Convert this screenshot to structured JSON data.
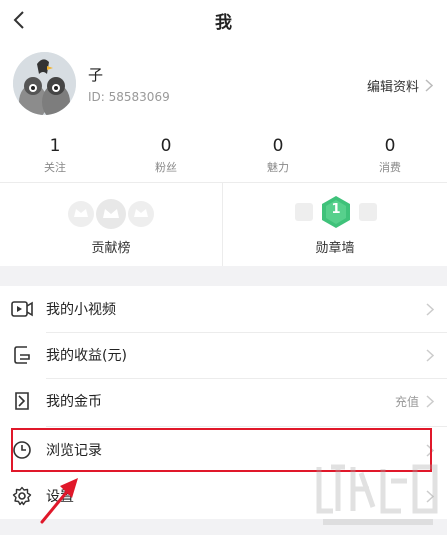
{
  "header": {
    "title": "我"
  },
  "profile": {
    "name": "子",
    "id_text": "ID: 58583069",
    "edit_label": "编辑资料"
  },
  "stats": [
    {
      "value": "1",
      "label": "关注"
    },
    {
      "value": "0",
      "label": "粉丝"
    },
    {
      "value": "0",
      "label": "魅力"
    },
    {
      "value": "0",
      "label": "消费"
    }
  ],
  "badges": [
    {
      "label": "贡献榜"
    },
    {
      "label": "勋章墙",
      "count": "1"
    }
  ],
  "menu": [
    {
      "label": "我的小视频",
      "trail": "",
      "icon": "video-icon"
    },
    {
      "label": "我的收益(元)",
      "trail": "",
      "icon": "wallet-icon"
    },
    {
      "label": "我的金币",
      "trail": "充值",
      "icon": "coin-book-icon"
    },
    {
      "label": "浏览记录",
      "trail": "",
      "icon": "clock-icon"
    },
    {
      "label": "设置",
      "trail": "",
      "icon": "gear-icon"
    }
  ],
  "colors": {
    "highlight": "#e0182a",
    "badge_green": "#3fc27a",
    "section_gap": "#f2f2f4"
  }
}
